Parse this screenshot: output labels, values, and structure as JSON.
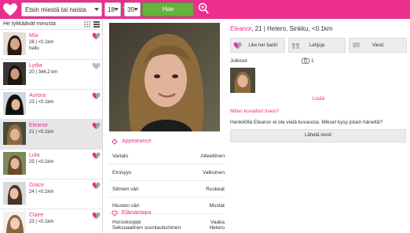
{
  "topbar": {
    "search_value": "Etsin miestä tai naista",
    "age_min": "18",
    "age_separator": "-",
    "age_max": "35",
    "search_button": "Hae",
    "accent": "#ec2f8e",
    "button_color": "#64b33a"
  },
  "sidebar": {
    "header": "He tykkäävät minusta",
    "items": [
      {
        "name": "Mia",
        "info": "28 | <0.1km",
        "note": "hello",
        "heart": "liked"
      },
      {
        "name": "Lydia",
        "info": "20 | 344,2 km",
        "note": "",
        "heart": "empty"
      },
      {
        "name": "Aurora",
        "info": "23 | <0.1km",
        "note": "",
        "heart": "liked"
      },
      {
        "name": "Eleanor",
        "info": "21 | <0.1km",
        "note": "",
        "heart": "liked",
        "selected": true
      },
      {
        "name": "Lola",
        "info": "25 | <0.1km",
        "note": "",
        "heart": "liked"
      },
      {
        "name": "Grace",
        "info": "24 | <0.1km",
        "note": "",
        "heart": "liked"
      },
      {
        "name": "Claire",
        "info": "23 | <0.1km",
        "note": "",
        "heart": "liked"
      }
    ]
  },
  "profile": {
    "name": "Eleanor",
    "details": ", 21 | Hetero, Sinkku, <0.1km",
    "appearance_title": "Appearance",
    "appearance": [
      {
        "key": "Vartalo",
        "value": "Atleettinen"
      },
      {
        "key": "Etnisyys",
        "value": "Valkoinen"
      },
      {
        "key": "Silmien väri",
        "value": "Ruskeat"
      },
      {
        "key": "Hiusten väri",
        "value": "Mustat"
      },
      {
        "key": "Horoskooppi",
        "value": "Vaaka"
      }
    ],
    "lifestyle_title": "Elämäntapa",
    "lifestyle": [
      {
        "key": "Seksuaalinen suuntautuminen",
        "value": "Hetero"
      }
    ]
  },
  "actions": {
    "like_back": "Like her back!",
    "gifts": "Lahjoja",
    "message": "Viesti"
  },
  "photos": {
    "label": "Julkiset",
    "count": "1",
    "more": "Lisää"
  },
  "question": {
    "title": "Miten kuvailisit itsesi?",
    "text": "Henkilöllä Eleanor ei ole vielä kuvausta. Mikset kysy jotain häneltä?",
    "send": "Lähetä viesti"
  }
}
